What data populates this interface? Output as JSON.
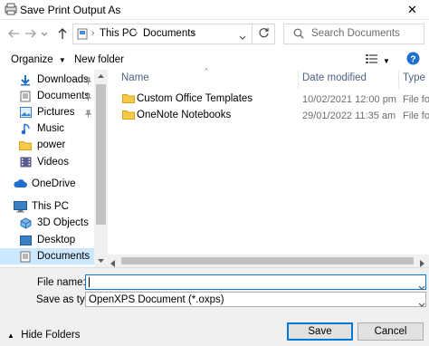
{
  "window": {
    "title": "Save Print Output As",
    "close_glyph": "✕"
  },
  "address": {
    "path": [
      "This PC",
      "Documents"
    ],
    "search_placeholder": "Search Documents"
  },
  "toolbar": {
    "organize_label": "Organize",
    "new_folder_label": "New folder"
  },
  "nav": {
    "items": [
      {
        "label": "Downloads",
        "icon": "download-icon"
      },
      {
        "label": "Documents",
        "icon": "documents-icon"
      },
      {
        "label": "Pictures",
        "icon": "pictures-icon"
      },
      {
        "label": "Music",
        "icon": "music-icon"
      },
      {
        "label": "power",
        "icon": "folder-icon"
      },
      {
        "label": "Videos",
        "icon": "videos-icon"
      },
      {
        "label": "OneDrive",
        "icon": "cloud-icon"
      },
      {
        "label": "This PC",
        "icon": "computer-icon"
      },
      {
        "label": "3D Objects",
        "icon": "3d-objects-icon"
      },
      {
        "label": "Desktop",
        "icon": "desktop-icon"
      },
      {
        "label": "Documents",
        "icon": "documents-icon"
      }
    ]
  },
  "files": {
    "columns": [
      "Name",
      "Date modified",
      "Type"
    ],
    "rows": [
      {
        "name": "Custom Office Templates",
        "date": "10/02/2021 12:00 pm",
        "type": "File fold"
      },
      {
        "name": "OneNote Notebooks",
        "date": "29/01/2022 11:35 am",
        "type": "File fold"
      }
    ]
  },
  "form": {
    "file_name_label": "File name:",
    "file_name_value": "",
    "save_as_type_label": "Save as type:",
    "save_as_type_value": "OpenXPS Document (*.oxps)"
  },
  "footer": {
    "hide_folders_label": "Hide Folders",
    "save_label": "Save",
    "cancel_label": "Cancel"
  },
  "colors": {
    "accent": "#0078d7",
    "selection": "#cce8ff",
    "folder": "#f7c948"
  }
}
